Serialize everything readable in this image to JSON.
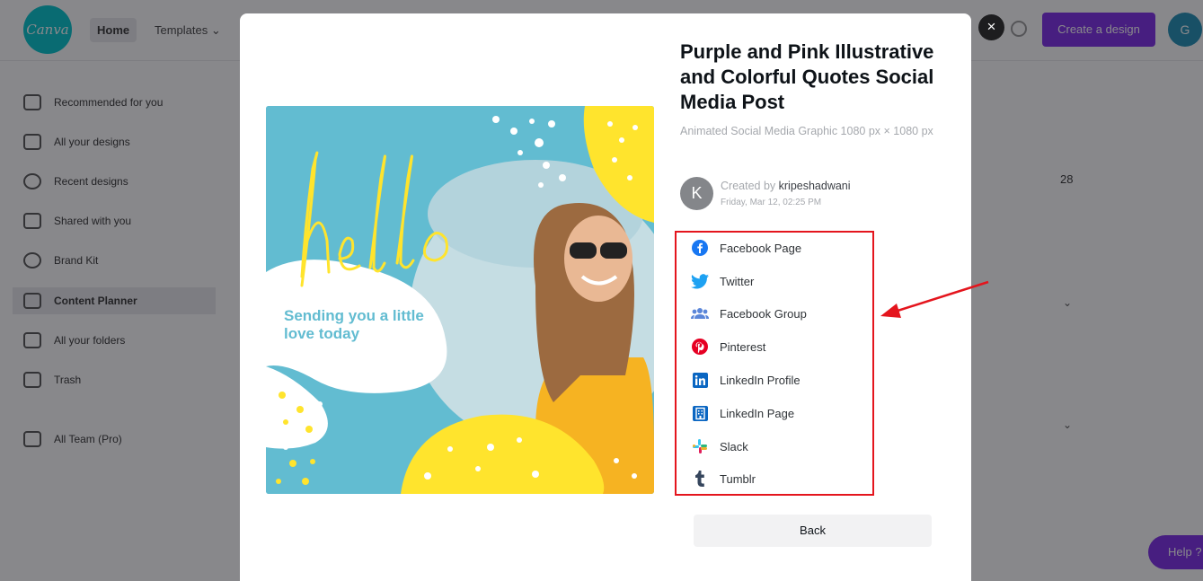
{
  "background": {
    "logo_text": "Canva",
    "nav": {
      "home": "Home",
      "templates": "Templates ⌄"
    },
    "create_button": "Create a design",
    "user_initials": "G",
    "sidebar": [
      {
        "label": "Recommended for you"
      },
      {
        "label": "All your designs"
      },
      {
        "label": "Recent designs"
      },
      {
        "label": "Shared with you"
      },
      {
        "label": "Brand Kit"
      },
      {
        "label": "Content Planner"
      },
      {
        "label": "All your folders"
      },
      {
        "label": "Trash"
      },
      {
        "label": "All Team (Pro)"
      }
    ],
    "calendar_day": "28",
    "help_button": "Help ?"
  },
  "modal": {
    "close_label": "×",
    "preview": {
      "script_text": "hello",
      "message": "Sending you a little love today"
    },
    "title": "Purple and Pink Illustrative and Colorful Quotes Social Media Post",
    "subtitle": "Animated Social Media Graphic 1080 px × 1080 px",
    "creator": {
      "initial": "K",
      "prefix": "Created by ",
      "name": "kripeshadwani",
      "date": "Friday, Mar 12, 02:25 PM"
    },
    "share_options": [
      {
        "label": "Facebook Page",
        "icon": "facebook-icon",
        "color": "#1877f2"
      },
      {
        "label": "Twitter",
        "icon": "twitter-icon",
        "color": "#1da1f2"
      },
      {
        "label": "Facebook Group",
        "icon": "facebook-group-icon",
        "color": "#5b86d9"
      },
      {
        "label": "Pinterest",
        "icon": "pinterest-icon",
        "color": "#e60023"
      },
      {
        "label": "LinkedIn Profile",
        "icon": "linkedin-icon",
        "color": "#0a66c2"
      },
      {
        "label": "LinkedIn Page",
        "icon": "linkedin-page-icon",
        "color": "#0a66c2"
      },
      {
        "label": "Slack",
        "icon": "slack-icon",
        "color": "#4a154b"
      },
      {
        "label": "Tumblr",
        "icon": "tumblr-icon",
        "color": "#36465d"
      }
    ],
    "back_button": "Back"
  },
  "colors": {
    "highlight": "#e4151d",
    "accent": "#7d2ae8",
    "preview_teal": "#62bcd1",
    "preview_yellow": "#ffe42d"
  }
}
